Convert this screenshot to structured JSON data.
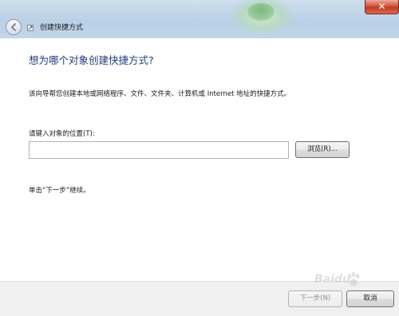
{
  "window": {
    "title": "创建快捷方式",
    "close_glyph": "✕"
  },
  "page": {
    "heading": "想为哪个对象创建快捷方式?",
    "description": "该向导帮您创建本地或网络程序、文件、文件夹、计算机或 Internet 地址的快捷方式。",
    "location_label": "请键入对象的位置(T):",
    "location_value": "",
    "browse_label": "浏览(R)...",
    "hint": "单击“下一步”继续。"
  },
  "footer": {
    "next_label": "下一步(N)",
    "cancel_label": "取消"
  },
  "watermark": {
    "text": "Baidu"
  },
  "icons": {
    "back": "back-arrow-icon",
    "wizard": "shortcut-wizard-icon",
    "close": "close-icon",
    "watermark_logo": "baidu-paw-icon"
  },
  "colors": {
    "heading": "#1e3c7a",
    "close_button": "#c33a20",
    "titlebar": "#b9d0e6",
    "footer_bg": "#f0f0f0"
  }
}
